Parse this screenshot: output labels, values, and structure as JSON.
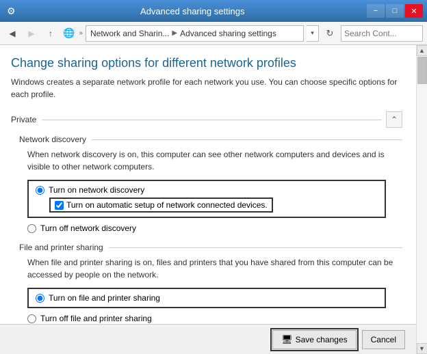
{
  "window": {
    "title": "Advanced sharing settings",
    "icon": "⚙"
  },
  "titlebar": {
    "minimize_label": "−",
    "maximize_label": "□",
    "close_label": "✕"
  },
  "addressbar": {
    "back_tooltip": "Back",
    "forward_tooltip": "Forward",
    "up_tooltip": "Up",
    "breadcrumb_parts": [
      "Network and Sharin...",
      "Advanced sharing settings"
    ],
    "dropdown_label": "▾",
    "refresh_label": "↻",
    "search_placeholder": "Search Cont...",
    "search_icon": "🔍"
  },
  "page": {
    "title": "Change sharing options for different network profiles",
    "description": "Windows creates a separate network profile for each network you use. You can choose specific options for each profile."
  },
  "private_section": {
    "label": "Private",
    "collapse_symbol": "^"
  },
  "network_discovery": {
    "subsection_label": "Network discovery",
    "description": "When network discovery is on, this computer can see other network computers and devices and is visible to other network computers.",
    "option_on_label": "Turn on network discovery",
    "option_auto_label": "Turn on automatic setup of network connected devices.",
    "option_off_label": "Turn off network discovery"
  },
  "file_printer": {
    "subsection_label": "File and printer sharing",
    "description": "When file and printer sharing is on, files and printers that you have shared from this computer can be accessed by people on the network.",
    "option_on_label": "Turn on file and printer sharing",
    "option_off_label": "Turn off file and printer sharing"
  },
  "bottom_bar": {
    "save_label": "Save changes",
    "cancel_label": "Cancel"
  }
}
